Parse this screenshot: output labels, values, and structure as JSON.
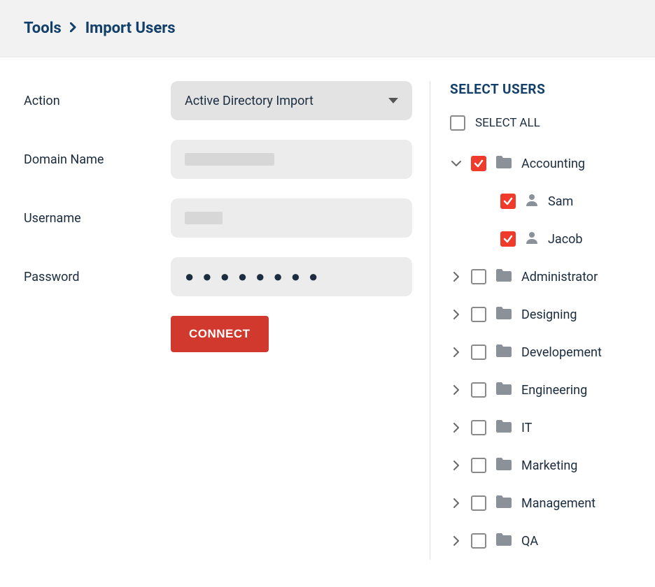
{
  "breadcrumb": {
    "parent": "Tools",
    "current": "Import Users"
  },
  "form": {
    "action_label": "Action",
    "action_value": "Active Directory Import",
    "domain_label": "Domain Name",
    "username_label": "Username",
    "password_label": "Password",
    "password_mask": "●●●●●●●●",
    "connect_button": "CONNECT"
  },
  "users_panel": {
    "title": "SELECT USERS",
    "select_all_label": "SELECT ALL",
    "select_all_checked": false,
    "groups": [
      {
        "name": "Accounting",
        "expanded": true,
        "checked": true,
        "users": [
          {
            "name": "Sam",
            "checked": true
          },
          {
            "name": "Jacob",
            "checked": true
          }
        ]
      },
      {
        "name": "Administrator",
        "expanded": false,
        "checked": false,
        "users": []
      },
      {
        "name": "Designing",
        "expanded": false,
        "checked": false,
        "users": []
      },
      {
        "name": "Developement",
        "expanded": false,
        "checked": false,
        "users": []
      },
      {
        "name": "Engineering",
        "expanded": false,
        "checked": false,
        "users": []
      },
      {
        "name": "IT",
        "expanded": false,
        "checked": false,
        "users": []
      },
      {
        "name": "Marketing",
        "expanded": false,
        "checked": false,
        "users": []
      },
      {
        "name": "Management",
        "expanded": false,
        "checked": false,
        "users": []
      },
      {
        "name": "QA",
        "expanded": false,
        "checked": false,
        "users": []
      }
    ]
  }
}
